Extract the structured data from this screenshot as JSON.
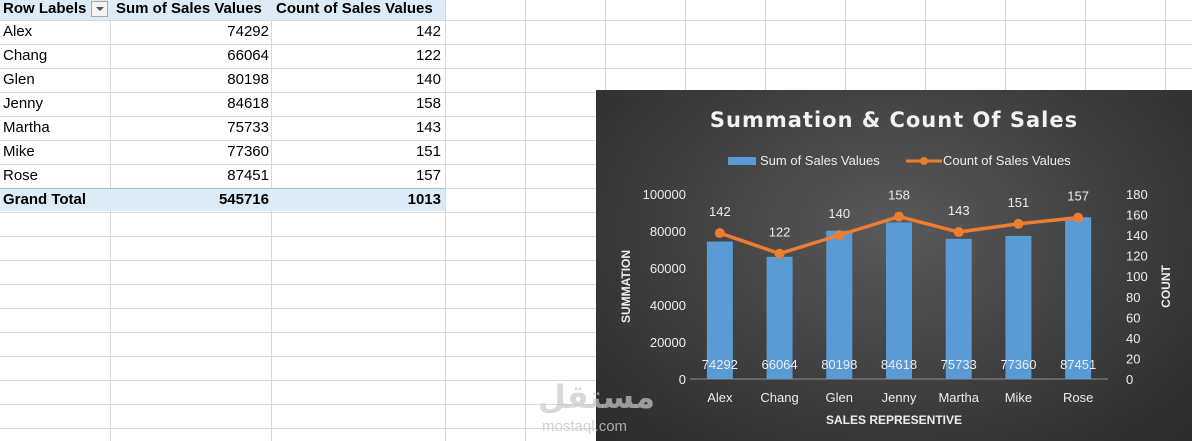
{
  "pivot": {
    "headers": [
      "Row Labels",
      "Sum of Sales Values",
      "Count of Sales Values"
    ],
    "rows": [
      {
        "label": "Alex",
        "sum": "74292",
        "count": "142"
      },
      {
        "label": "Chang",
        "sum": "66064",
        "count": "122"
      },
      {
        "label": "Glen",
        "sum": "80198",
        "count": "140"
      },
      {
        "label": "Jenny",
        "sum": "84618",
        "count": "158"
      },
      {
        "label": "Martha",
        "sum": "75733",
        "count": "143"
      },
      {
        "label": "Mike",
        "sum": "77360",
        "count": "151"
      },
      {
        "label": "Rose",
        "sum": "87451",
        "count": "157"
      }
    ],
    "total": {
      "label": "Grand Total",
      "sum": "545716",
      "count": "1013"
    }
  },
  "chart_data": {
    "type": "bar",
    "title": "Summation & Count Of Sales",
    "xlabel": "SALES REPRESENTIVE",
    "ylabel": "SUMMATION",
    "y2label": "COUNT",
    "categories": [
      "Alex",
      "Chang",
      "Glen",
      "Jenny",
      "Martha",
      "Mike",
      "Rose"
    ],
    "series": [
      {
        "name": "Sum of Sales Values",
        "type": "bar",
        "axis": "left",
        "color": "#5b9bd5",
        "values": [
          74292,
          66064,
          80198,
          84618,
          75733,
          77360,
          87451
        ]
      },
      {
        "name": "Count of Sales Values",
        "type": "line",
        "axis": "right",
        "color": "#ed7d31",
        "values": [
          142,
          122,
          140,
          158,
          143,
          151,
          157
        ]
      }
    ],
    "ylim": [
      0,
      100000
    ],
    "yticks": [
      0,
      20000,
      40000,
      60000,
      80000,
      100000
    ],
    "y2lim": [
      0,
      180
    ],
    "y2ticks": [
      0,
      20,
      40,
      60,
      80,
      100,
      120,
      140,
      160,
      180
    ],
    "legend": "top",
    "grid": false
  },
  "watermark": {
    "arabic": "مستقل",
    "latin": "mostaql.com"
  }
}
